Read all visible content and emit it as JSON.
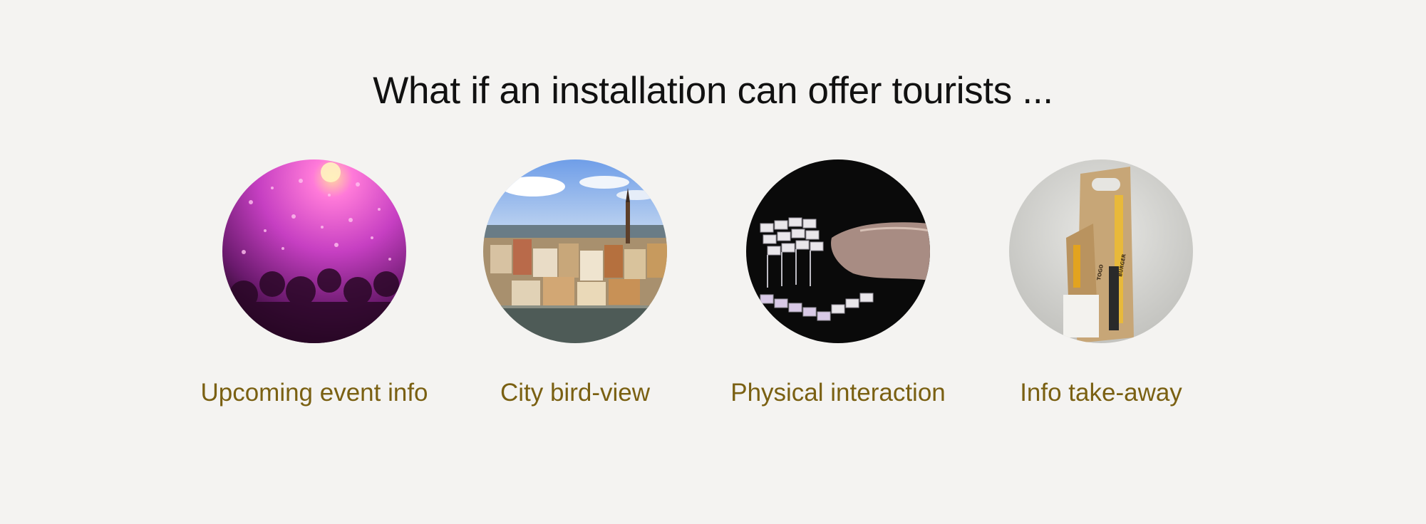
{
  "slide": {
    "title": "What if an installation can offer tourists ...",
    "items": [
      {
        "label": "Upcoming event info",
        "image": "concert-crowd-photo"
      },
      {
        "label": "City bird-view",
        "image": "city-aerial-photo"
      },
      {
        "label": "Physical interaction",
        "image": "hand-on-tactile-model-photo"
      },
      {
        "label": "Info take-away",
        "image": "cardboard-takeaway-carrier-photo"
      }
    ]
  },
  "colors": {
    "background": "#f4f3f1",
    "title": "#111111",
    "label": "#7a6012"
  }
}
